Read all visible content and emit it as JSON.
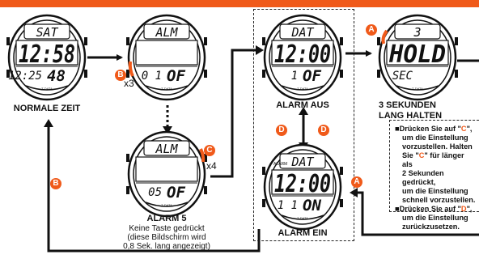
{
  "watches": {
    "normal": {
      "top": "SAT",
      "main": "12:58",
      "sub_left": "12:25",
      "sub_right": "48",
      "label": "NORMALE ZEIT"
    },
    "alm_set": {
      "top": "ALM",
      "main": "",
      "sub_left": "0 1",
      "sub_right": "OF"
    },
    "alm5": {
      "top": "ALM",
      "main": "",
      "sub_left": "05",
      "sub_right": "OF",
      "label": "ALARM 5",
      "sub_lines": [
        "Keine Taste gedrückt",
        "(diese Bildschirm wird",
        "0,8 Sek. lang angezeigt)"
      ]
    },
    "alarm_aus": {
      "top": "DAT",
      "main": "12:00",
      "sub_left": "1",
      "sub_right": "OF",
      "label": "ALARM AUS"
    },
    "alarm_ein": {
      "top_left": "ALARM",
      "top": "DAT",
      "main": "12:00",
      "sub_left": "1 1",
      "sub_right": "ON",
      "label": "ALARM EIN"
    },
    "hold": {
      "top": "3",
      "main": "HOLD",
      "sub_left": "SEC",
      "label_lines": [
        "3 SEKUNDEN",
        "LANG HALTEN"
      ]
    }
  },
  "bezel_text": "T-DATA",
  "badges": {
    "a": "A",
    "b": "B",
    "c": "C",
    "d": "D"
  },
  "multipliers": {
    "x3": "x3",
    "x4": "x4"
  },
  "info": {
    "lines": [
      {
        "bullet": true,
        "pre": "Drücken Sie auf \"",
        "key": "C",
        "post": "\","
      },
      {
        "bullet": false,
        "text": "um die Einstellung"
      },
      {
        "bullet": false,
        "text": "vorzustellen. Halten"
      },
      {
        "bullet": false,
        "pre": "Sie \"",
        "key": "C",
        "post": "\" für länger als"
      },
      {
        "bullet": false,
        "text": "2 Sekunden gedrückt,"
      },
      {
        "bullet": false,
        "text": "um die Einstellung"
      },
      {
        "bullet": false,
        "text": "schnell vorzustellen."
      },
      {
        "bullet": true,
        "pre": "Drücken Sie auf \"",
        "key": "D",
        "post": "\","
      },
      {
        "bullet": false,
        "text": "um die Einstellung"
      },
      {
        "bullet": false,
        "text": "zurückzusetzen."
      }
    ]
  },
  "colors": {
    "accent": "#f05a1a",
    "ink": "#111111"
  }
}
